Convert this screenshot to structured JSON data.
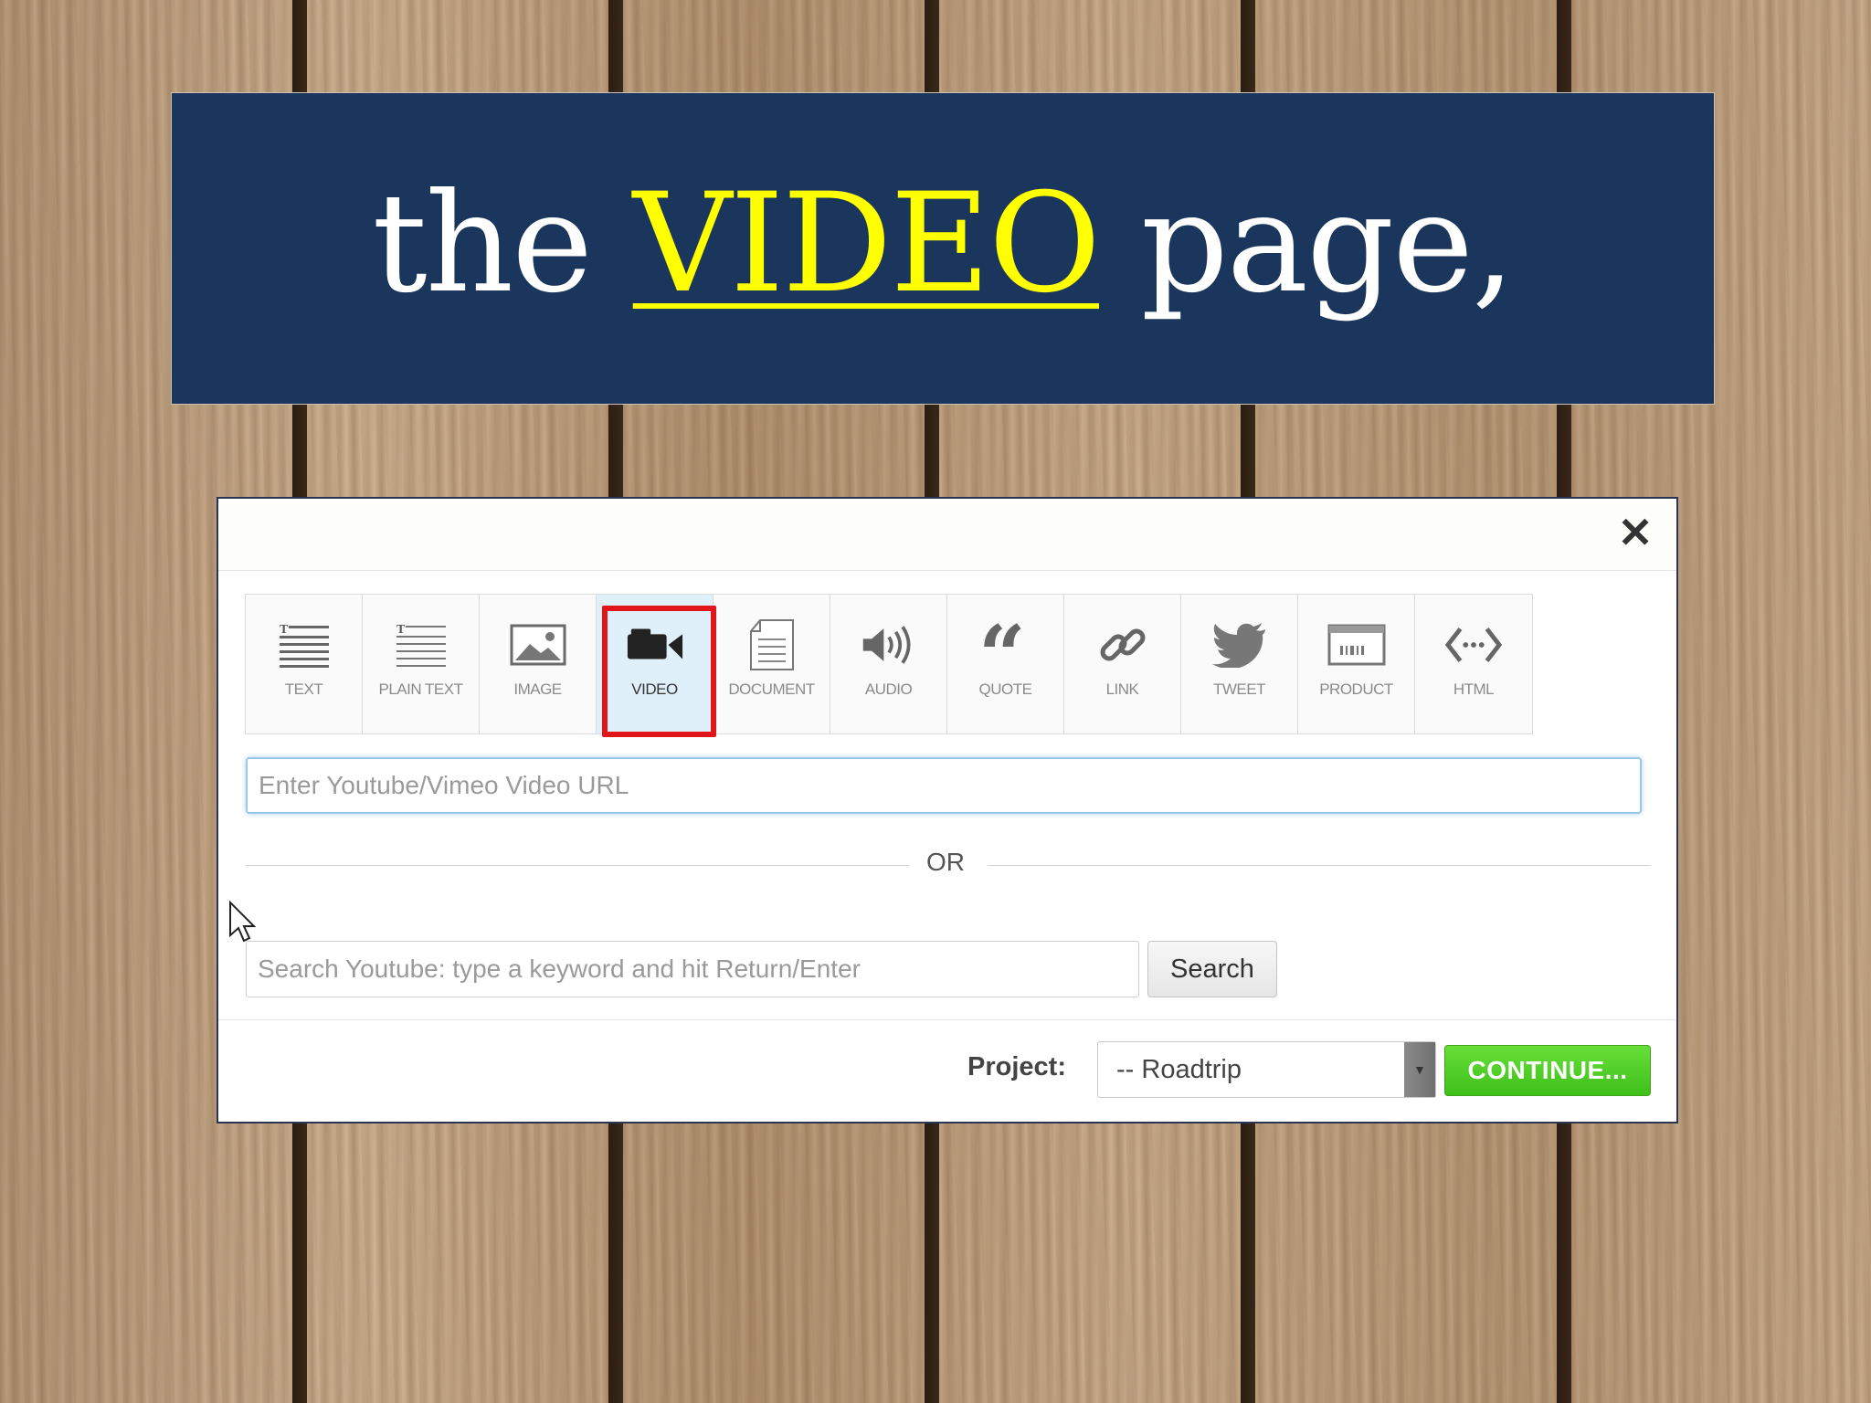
{
  "banner": {
    "title_before": "the",
    "title_highlight": "VIDEO",
    "title_after": "page,"
  },
  "dialog": {
    "close_glyph": "✕",
    "toolbar": [
      {
        "label": "TEXT",
        "icon": "text-lines-icon"
      },
      {
        "label": "PLAIN TEXT",
        "icon": "plain-text-icon"
      },
      {
        "label": "IMAGE",
        "icon": "image-icon"
      },
      {
        "label": "VIDEO",
        "icon": "video-camera-icon"
      },
      {
        "label": "DOCUMENT",
        "icon": "document-icon"
      },
      {
        "label": "AUDIO",
        "icon": "speaker-icon"
      },
      {
        "label": "QUOTE",
        "icon": "quote-icon"
      },
      {
        "label": "LINK",
        "icon": "link-icon"
      },
      {
        "label": "TWEET",
        "icon": "twitter-bird-icon"
      },
      {
        "label": "PRODUCT",
        "icon": "product-icon"
      },
      {
        "label": "HTML",
        "icon": "code-icon"
      }
    ],
    "active_tool": "VIDEO",
    "url_placeholder": "Enter Youtube/Vimeo Video URL",
    "or_text": "OR",
    "search_placeholder": "Search Youtube: type a keyword and hit Return/Enter",
    "search_button": "Search",
    "project_label": "Project:",
    "project_value": "-- Roadtrip",
    "continue_button": "CONTINUE..."
  },
  "colors": {
    "banner_bg": "#1b365d",
    "highlight": "#ffff00",
    "active_outline": "#e0161a",
    "continue_green": "#4fcb25"
  }
}
